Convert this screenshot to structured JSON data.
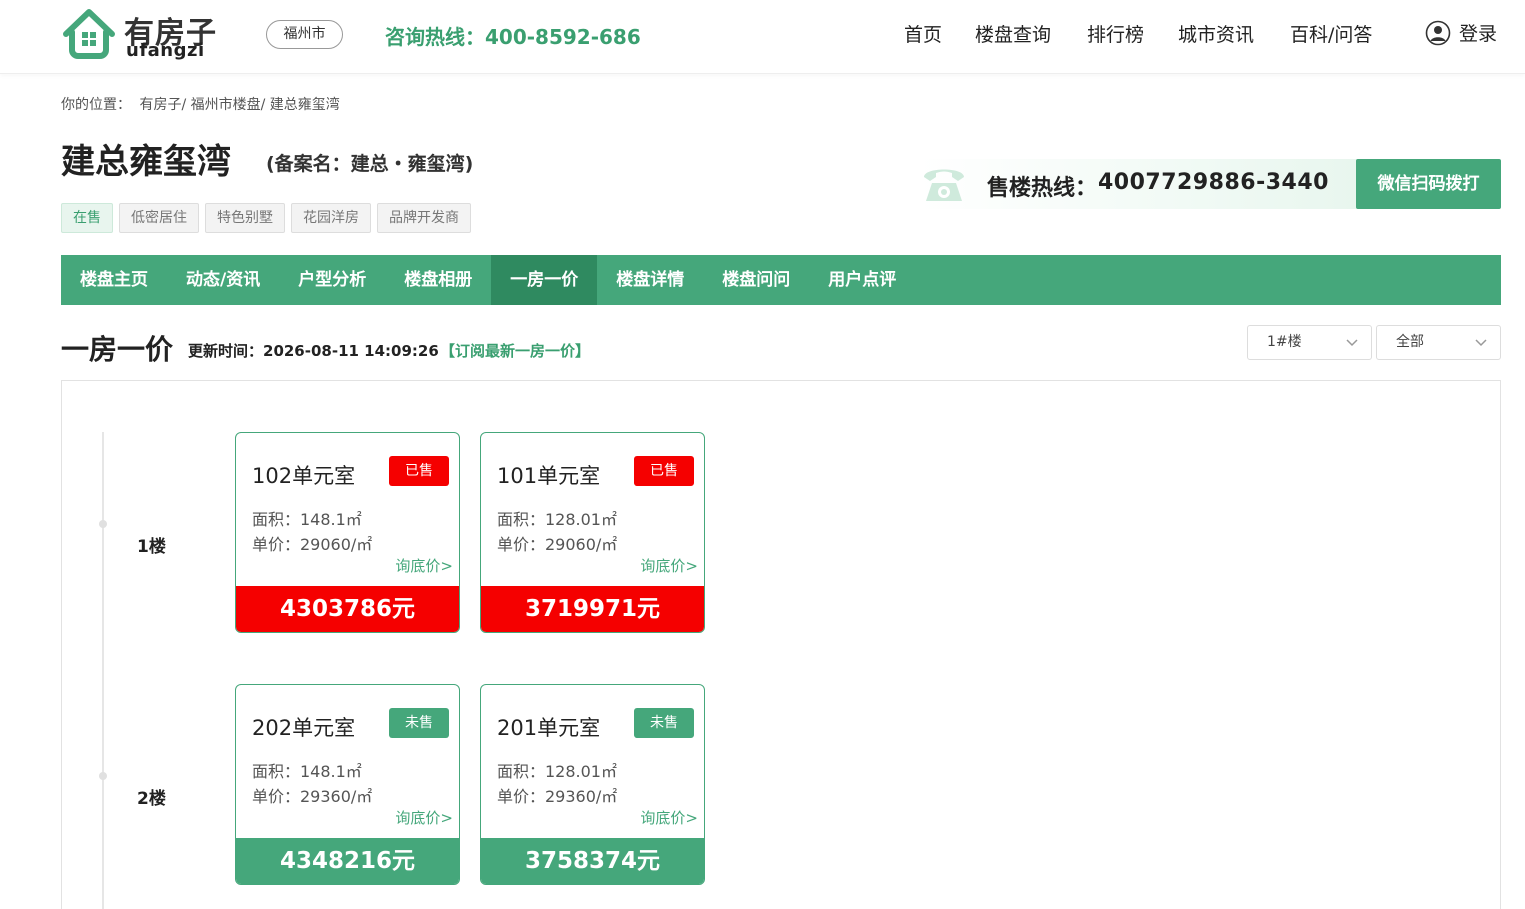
{
  "header": {
    "logo_main": "有房子",
    "logo_sub": "ufangzi",
    "city": "福州市",
    "hotline": "咨询热线：400-8592-686",
    "nav": [
      "首页",
      "楼盘查询",
      "排行榜",
      "城市资讯",
      "百科/问答"
    ],
    "login": "登录"
  },
  "breadcrumb": {
    "prefix": "你的位置：",
    "path": "有房子/ 福州市楼盘/ 建总雍玺湾"
  },
  "property": {
    "name": "建总雍玺湾",
    "alias": "(备案名：建总・雍玺湾)",
    "tags": [
      "在售",
      "低密居住",
      "特色别墅",
      "花园洋房",
      "品牌开发商"
    ],
    "sales_label": "售楼热线：",
    "sales_number": "4007729886-3440",
    "wechat_button": "微信扫码拨打"
  },
  "tabs": [
    "楼盘主页",
    "动态/资讯",
    "户型分析",
    "楼盘相册",
    "一房一价",
    "楼盘详情",
    "楼盘问问",
    "用户点评"
  ],
  "active_tab": "一房一价",
  "section": {
    "title": "一房一价",
    "update_time": "更新时间：2026-08-11 14:09:26",
    "subscribe": "【订阅最新一房一价】",
    "building_select": "1#楼",
    "filter_select": "全部"
  },
  "floors": [
    {
      "label": "1楼",
      "units": [
        {
          "room": "102单元室",
          "status": "已售",
          "area": "面积：148.1㎡",
          "unit_price": "单价：29060/㎡",
          "ask": "询底价>",
          "total": "4303786元"
        },
        {
          "room": "101单元室",
          "status": "已售",
          "area": "面积：128.01㎡",
          "unit_price": "单价：29060/㎡",
          "ask": "询底价>",
          "total": "3719971元"
        }
      ]
    },
    {
      "label": "2楼",
      "units": [
        {
          "room": "202单元室",
          "status": "未售",
          "area": "面积：148.1㎡",
          "unit_price": "单价：29360/㎡",
          "ask": "询底价>",
          "total": "4348216元"
        },
        {
          "room": "201单元室",
          "status": "未售",
          "area": "面积：128.01㎡",
          "unit_price": "单价：29360/㎡",
          "ask": "询底价>",
          "total": "3758374元"
        }
      ]
    }
  ],
  "colors": {
    "brand": "#45a77b",
    "sold": "#f50000"
  }
}
